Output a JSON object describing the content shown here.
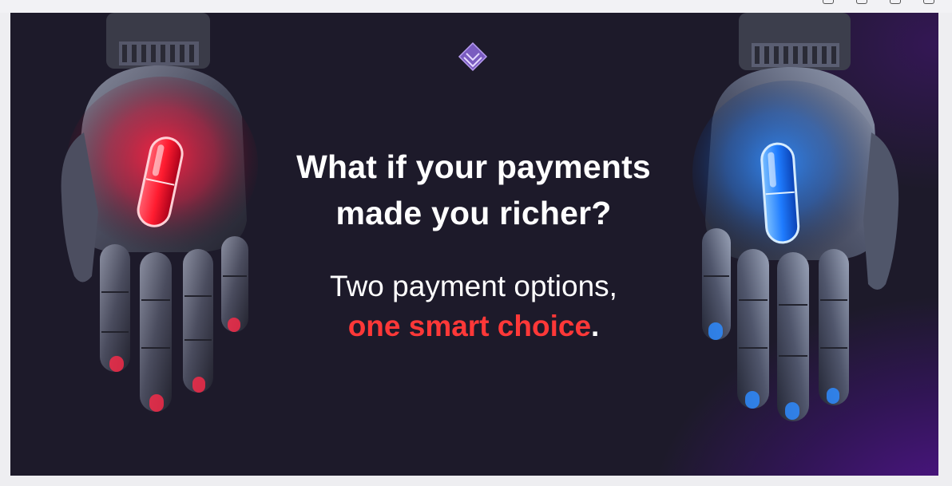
{
  "browser": {
    "tab_text": "",
    "icons": [
      "menu-icon",
      "window-icon",
      "window-icon",
      "window-icon",
      "window-icon"
    ]
  },
  "hero": {
    "logo_icon": "layered-diamond-icon",
    "headline_line1": "What if your payments",
    "headline_line2": "made you richer?",
    "subline_line1": "Two payment options,",
    "subline_highlight": "one smart choice",
    "subline_period": ".",
    "left_image": "robot-hand-red-pill",
    "right_image": "robot-hand-blue-pill"
  },
  "colors": {
    "background": "#1d1a2a",
    "accent_red": "#ff3838",
    "accent_blue": "#2e8bff",
    "accent_purple": "#5a1e96",
    "text": "#ffffff"
  }
}
